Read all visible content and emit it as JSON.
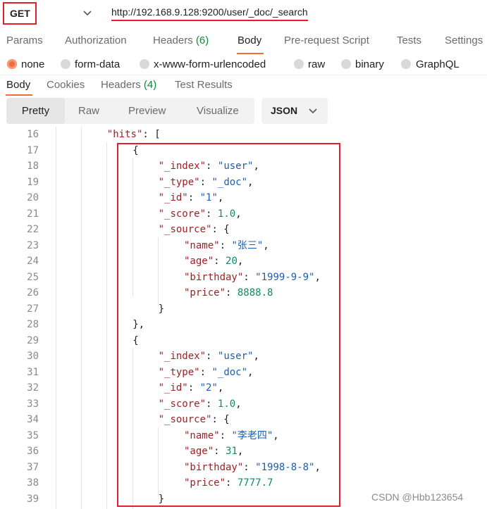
{
  "request": {
    "method": "GET",
    "url": "http://192.168.9.128:9200/user/_doc/_search"
  },
  "request_tabs": [
    {
      "label": "Params",
      "count": ""
    },
    {
      "label": "Authorization",
      "count": ""
    },
    {
      "label": "Headers",
      "count": "(6)"
    },
    {
      "label": "Body",
      "count": ""
    },
    {
      "label": "Pre-request Script",
      "count": ""
    },
    {
      "label": "Tests",
      "count": ""
    },
    {
      "label": "Settings",
      "count": ""
    }
  ],
  "body_types": [
    "none",
    "form-data",
    "x-www-form-urlencoded",
    "raw",
    "binary",
    "GraphQL"
  ],
  "response_tabs": [
    {
      "label": "Body",
      "count": ""
    },
    {
      "label": "Cookies",
      "count": ""
    },
    {
      "label": "Headers",
      "count": "(4)"
    },
    {
      "label": "Test Results",
      "count": ""
    }
  ],
  "view_modes": [
    "Pretty",
    "Raw",
    "Preview",
    "Visualize"
  ],
  "format": "JSON",
  "code_lines": [
    {
      "n": "16",
      "indent": 2,
      "tokens": [
        {
          "t": "k",
          "v": "\"hits\""
        },
        {
          "t": "p",
          "v": ": ["
        }
      ]
    },
    {
      "n": "17",
      "indent": 3,
      "tokens": [
        {
          "t": "p",
          "v": "{"
        }
      ]
    },
    {
      "n": "18",
      "indent": 4,
      "tokens": [
        {
          "t": "k",
          "v": "\"_index\""
        },
        {
          "t": "p",
          "v": ": "
        },
        {
          "t": "s",
          "v": "\"user\""
        },
        {
          "t": "p",
          "v": ","
        }
      ]
    },
    {
      "n": "19",
      "indent": 4,
      "tokens": [
        {
          "t": "k",
          "v": "\"_type\""
        },
        {
          "t": "p",
          "v": ": "
        },
        {
          "t": "s",
          "v": "\"_doc\""
        },
        {
          "t": "p",
          "v": ","
        }
      ]
    },
    {
      "n": "20",
      "indent": 4,
      "tokens": [
        {
          "t": "k",
          "v": "\"_id\""
        },
        {
          "t": "p",
          "v": ": "
        },
        {
          "t": "s",
          "v": "\"1\""
        },
        {
          "t": "p",
          "v": ","
        }
      ]
    },
    {
      "n": "21",
      "indent": 4,
      "tokens": [
        {
          "t": "k",
          "v": "\"_score\""
        },
        {
          "t": "p",
          "v": ": "
        },
        {
          "t": "n",
          "v": "1.0"
        },
        {
          "t": "p",
          "v": ","
        }
      ]
    },
    {
      "n": "22",
      "indent": 4,
      "tokens": [
        {
          "t": "k",
          "v": "\"_source\""
        },
        {
          "t": "p",
          "v": ": {"
        }
      ]
    },
    {
      "n": "23",
      "indent": 5,
      "tokens": [
        {
          "t": "k",
          "v": "\"name\""
        },
        {
          "t": "p",
          "v": ": "
        },
        {
          "t": "s",
          "v": "\"张三\""
        },
        {
          "t": "p",
          "v": ","
        }
      ]
    },
    {
      "n": "24",
      "indent": 5,
      "tokens": [
        {
          "t": "k",
          "v": "\"age\""
        },
        {
          "t": "p",
          "v": ": "
        },
        {
          "t": "n",
          "v": "20"
        },
        {
          "t": "p",
          "v": ","
        }
      ]
    },
    {
      "n": "25",
      "indent": 5,
      "tokens": [
        {
          "t": "k",
          "v": "\"birthday\""
        },
        {
          "t": "p",
          "v": ": "
        },
        {
          "t": "s",
          "v": "\"1999-9-9\""
        },
        {
          "t": "p",
          "v": ","
        }
      ]
    },
    {
      "n": "26",
      "indent": 5,
      "tokens": [
        {
          "t": "k",
          "v": "\"price\""
        },
        {
          "t": "p",
          "v": ": "
        },
        {
          "t": "n",
          "v": "8888.8"
        }
      ]
    },
    {
      "n": "27",
      "indent": 4,
      "tokens": [
        {
          "t": "p",
          "v": "}"
        }
      ]
    },
    {
      "n": "28",
      "indent": 3,
      "tokens": [
        {
          "t": "p",
          "v": "},"
        }
      ]
    },
    {
      "n": "29",
      "indent": 3,
      "tokens": [
        {
          "t": "p",
          "v": "{"
        }
      ]
    },
    {
      "n": "30",
      "indent": 4,
      "tokens": [
        {
          "t": "k",
          "v": "\"_index\""
        },
        {
          "t": "p",
          "v": ": "
        },
        {
          "t": "s",
          "v": "\"user\""
        },
        {
          "t": "p",
          "v": ","
        }
      ]
    },
    {
      "n": "31",
      "indent": 4,
      "tokens": [
        {
          "t": "k",
          "v": "\"_type\""
        },
        {
          "t": "p",
          "v": ": "
        },
        {
          "t": "s",
          "v": "\"_doc\""
        },
        {
          "t": "p",
          "v": ","
        }
      ]
    },
    {
      "n": "32",
      "indent": 4,
      "tokens": [
        {
          "t": "k",
          "v": "\"_id\""
        },
        {
          "t": "p",
          "v": ": "
        },
        {
          "t": "s",
          "v": "\"2\""
        },
        {
          "t": "p",
          "v": ","
        }
      ]
    },
    {
      "n": "33",
      "indent": 4,
      "tokens": [
        {
          "t": "k",
          "v": "\"_score\""
        },
        {
          "t": "p",
          "v": ": "
        },
        {
          "t": "n",
          "v": "1.0"
        },
        {
          "t": "p",
          "v": ","
        }
      ]
    },
    {
      "n": "34",
      "indent": 4,
      "tokens": [
        {
          "t": "k",
          "v": "\"_source\""
        },
        {
          "t": "p",
          "v": ": {"
        }
      ]
    },
    {
      "n": "35",
      "indent": 5,
      "tokens": [
        {
          "t": "k",
          "v": "\"name\""
        },
        {
          "t": "p",
          "v": ": "
        },
        {
          "t": "s",
          "v": "\"李老四\""
        },
        {
          "t": "p",
          "v": ","
        }
      ]
    },
    {
      "n": "36",
      "indent": 5,
      "tokens": [
        {
          "t": "k",
          "v": "\"age\""
        },
        {
          "t": "p",
          "v": ": "
        },
        {
          "t": "n",
          "v": "31"
        },
        {
          "t": "p",
          "v": ","
        }
      ]
    },
    {
      "n": "37",
      "indent": 5,
      "tokens": [
        {
          "t": "k",
          "v": "\"birthday\""
        },
        {
          "t": "p",
          "v": ": "
        },
        {
          "t": "s",
          "v": "\"1998-8-8\""
        },
        {
          "t": "p",
          "v": ","
        }
      ]
    },
    {
      "n": "38",
      "indent": 5,
      "tokens": [
        {
          "t": "k",
          "v": "\"price\""
        },
        {
          "t": "p",
          "v": ": "
        },
        {
          "t": "n",
          "v": "7777.7"
        }
      ]
    },
    {
      "n": "39",
      "indent": 4,
      "tokens": [
        {
          "t": "p",
          "v": "}"
        }
      ]
    }
  ],
  "watermark": "CSDN @Hbb123654",
  "colors": {
    "accent": "#f26b3a",
    "highlight_border": "#e0202a",
    "json_key": "#9b2226",
    "json_string": "#1a5fb4",
    "json_number": "#128a66",
    "count_green": "#0a8a3a"
  }
}
